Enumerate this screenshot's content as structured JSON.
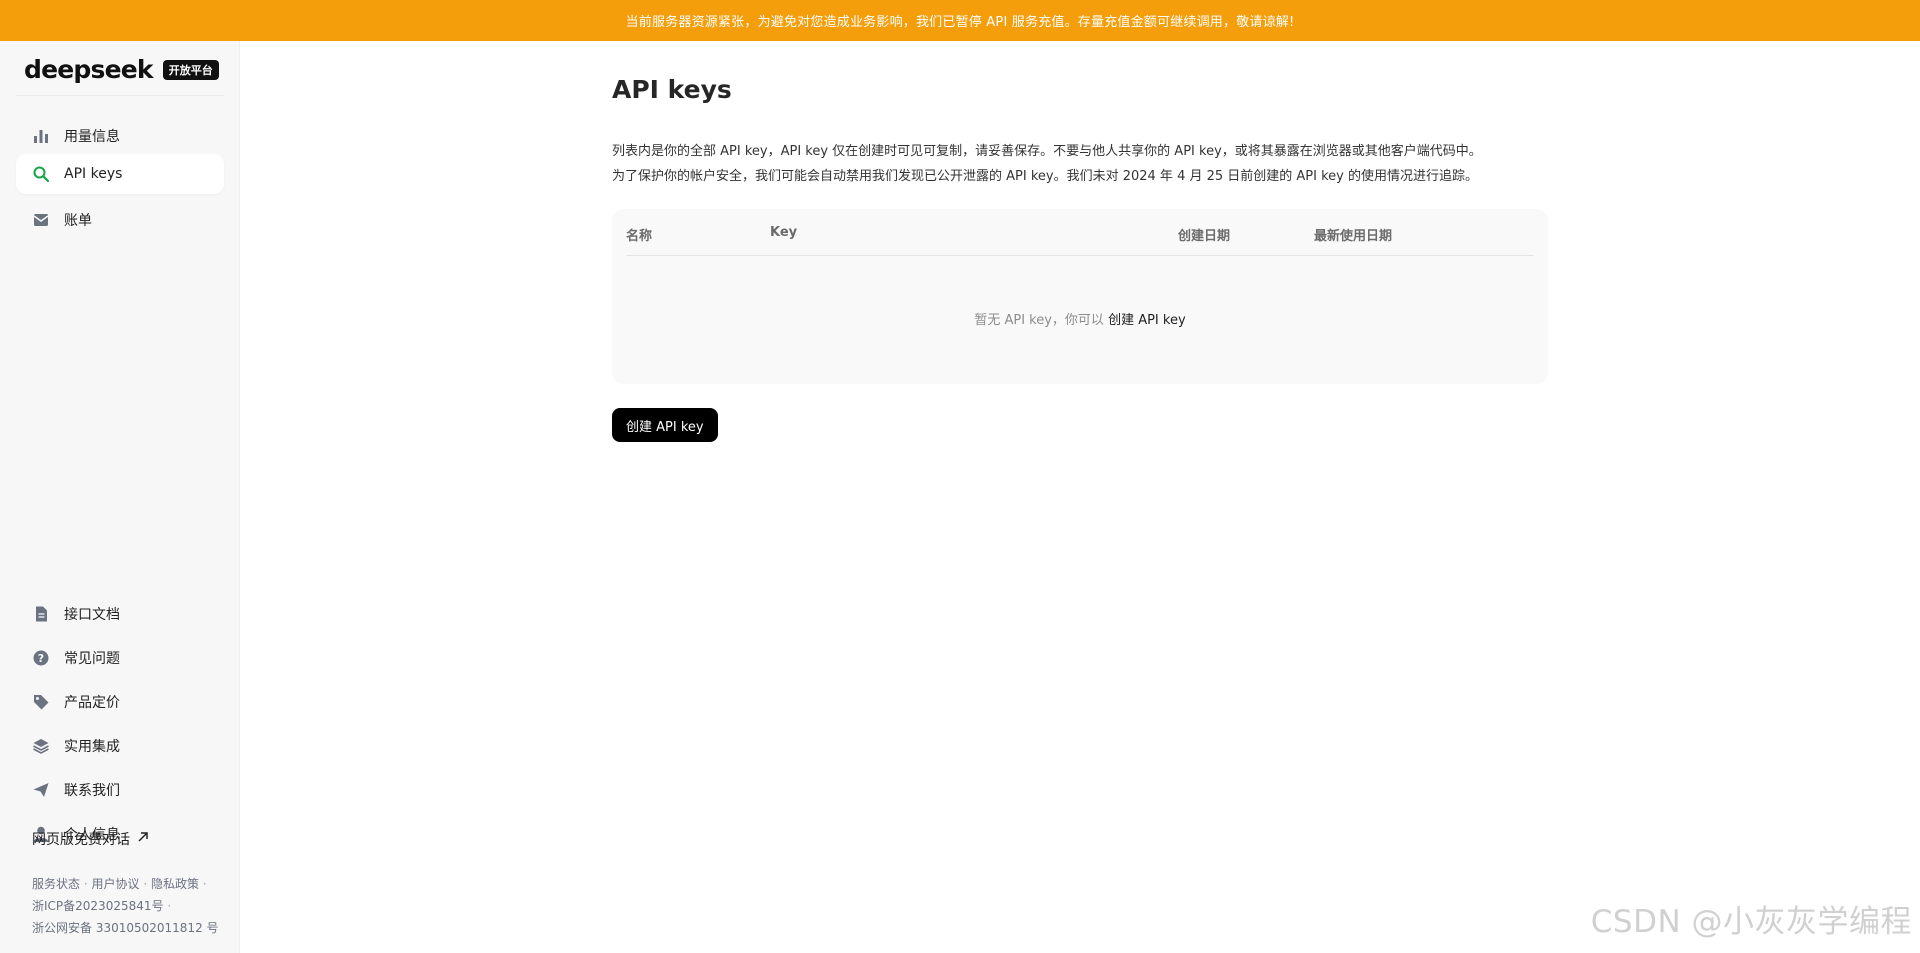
{
  "banner": {
    "text": "当前服务器资源紧张，为避免对您造成业务影响，我们已暂停 API 服务充值。存量充值金额可继续调用，敬请谅解!"
  },
  "brand": {
    "logo_text": "deepseek",
    "badge": "开放平台"
  },
  "sidebar": {
    "top_items": [
      {
        "label": "用量信息",
        "icon": "bar-chart-icon",
        "active": false
      },
      {
        "label": "API keys",
        "icon": "search-icon",
        "active": true
      },
      {
        "label": "账单",
        "icon": "bill-icon",
        "active": false
      }
    ],
    "bottom_items": [
      {
        "label": "接口文档",
        "icon": "document-icon"
      },
      {
        "label": "常见问题",
        "icon": "question-icon"
      },
      {
        "label": "产品定价",
        "icon": "tag-icon"
      },
      {
        "label": "实用集成",
        "icon": "layers-icon"
      },
      {
        "label": "联系我们",
        "icon": "send-icon"
      },
      {
        "label": "个人信息",
        "icon": "user-icon"
      }
    ],
    "web_chat": "网页版免费对话",
    "footer": {
      "service_status": "服务状态",
      "user_agreement": "用户协议",
      "privacy": "隐私政策",
      "icp": "浙ICP备2023025841号",
      "police": "浙公网安备 33010502011812 号"
    }
  },
  "main": {
    "title": "API keys",
    "desc_line1": "列表内是你的全部 API key，API key 仅在创建时可见可复制，请妥善保存。不要与他人共享你的 API key，或将其暴露在浏览器或其他客户端代码中。",
    "desc_line2": "为了保护你的帐户安全，我们可能会自动禁用我们发现已公开泄露的 API key。我们未对 2024 年 4 月 25 日前创建的 API key 的使用情况进行追踪。",
    "table": {
      "columns": [
        "名称",
        "Key",
        "创建日期",
        "最新使用日期"
      ],
      "empty_prefix": "暂无 API key，你可以",
      "empty_link": "创建 API key"
    },
    "create_button": "创建 API key"
  },
  "watermark": "CSDN @小灰灰学编程"
}
